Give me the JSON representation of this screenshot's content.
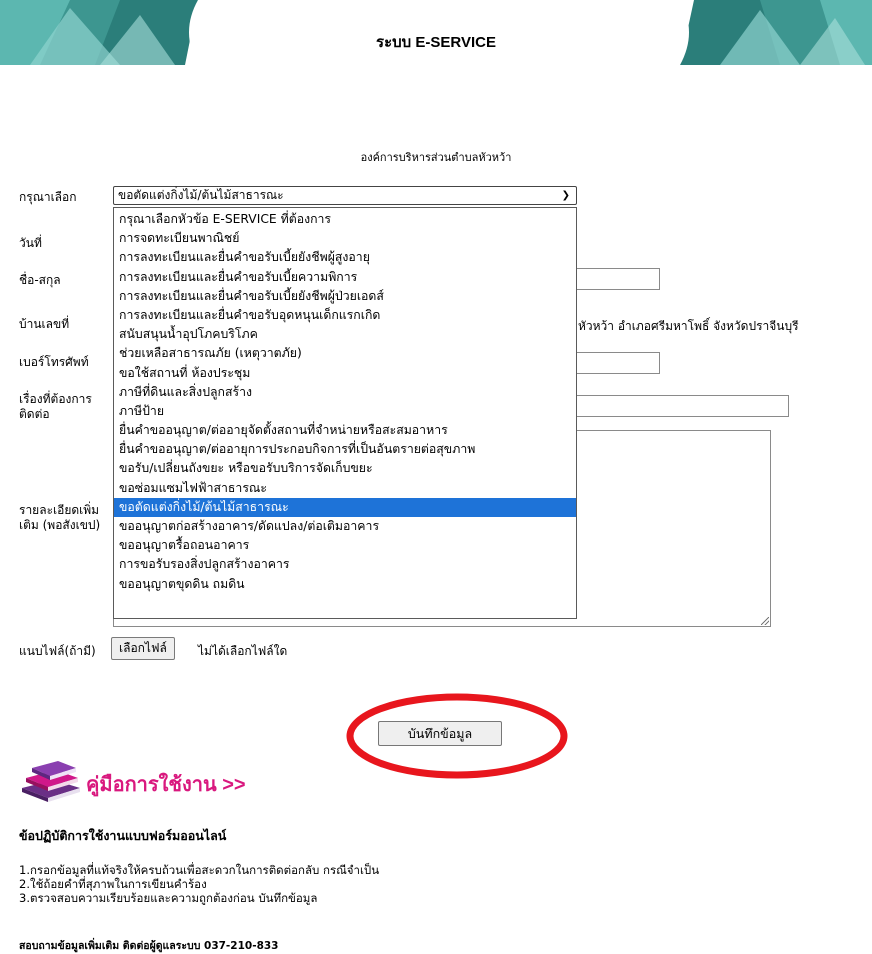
{
  "header": {
    "system_title": "ระบบ E-SERVICE",
    "org_name": "องค์การบริหารส่วนตำบลหัวหว้า",
    "banner_colors": [
      "#2a7f7b",
      "#55b4ae",
      "#8fd3ce"
    ]
  },
  "form": {
    "labels": {
      "topic": "กรุณาเลือก",
      "date": "วันที่",
      "name": "ชื่อ-สกุล",
      "address": "บ้านเลขที่",
      "phone": "เบอร์โทรศัพท์",
      "subject": "เรื่องที่ต้องการติดต่อ",
      "details": "รายละเอียดเพิ่มเติม (พอสังเขป)",
      "attach": "แนบไฟล์(ถ้ามี)"
    },
    "address_suffix": "หัวหว้า อำเภอศรีมหาโพธิ์ จังหวัดปราจีนบุรี",
    "selected_topic": "ขอตัดแต่งกิ่งไม้/ต้นไม้สาธารณะ",
    "topic_options": [
      "กรุณาเลือกหัวข้อ E-SERVICE ที่ต้องการ",
      "การจดทะเบียนพาณิชย์",
      "การลงทะเบียนและยื่นคำขอรับเบี้ยยังชีพผู้สูงอายุ",
      "การลงทะเบียนและยื่นคำขอรับเบี้ยความพิการ",
      "การลงทะเบียนและยื่นคำขอรับเบี้ยยังชีพผู้ป่วยเอดส์",
      "การลงทะเบียนและยื่นคำขอรับอุดหนุนเด็กแรกเกิด",
      "สนับสนุนน้ำอุปโภคบริโภค",
      "ช่วยเหลือสาธารณภัย (เหตุวาตภัย)",
      "ขอใช้สถานที่ ห้องประชุม",
      "ภาษีที่ดินและสิ่งปลูกสร้าง",
      "ภาษีป้าย",
      "ยื่นคำขออนุญาต/ต่ออายุจัดตั้งสถานที่จำหน่ายหรือสะสมอาหาร",
      "ยื่นคำขออนุญาต/ต่ออายุการประกอบกิจการที่เป็นอันตรายต่อสุขภาพ",
      "ขอรับ/เปลี่ยนถังขยะ หรือขอรับบริการจัดเก็บขยะ",
      "ขอซ่อมแซมไฟฟ้าสาธารณะ",
      "ขอตัดแต่งกิ่งไม้/ต้นไม้สาธารณะ",
      "ขออนุญาตก่อสร้างอาคาร/ดัดแปลง/ต่อเติมอาคาร",
      "ขออนุญาตรื้อถอนอาคาร",
      "การขอรับรองสิ่งปลูกสร้างอาคาร",
      "ขออนุญาตขุดดิน ถมดิน"
    ],
    "selected_index": 15,
    "choose_file_label": "เลือกไฟล์",
    "no_file_text": "ไม่ได้เลือกไฟล์ใด",
    "save_label": "บันทึกข้อมูล"
  },
  "manual": {
    "label": "คู่มือการใช้งาน >>"
  },
  "rules": {
    "title": "ข้อปฏิบัติการใช้งานแบบฟอร์มออนไลน์",
    "items": [
      "1.กรอกข้อมูลที่แท้จริงให้ครบถ้วนเพื่อสะดวกในการติดต่อกลับ กรณีจำเป็น",
      "2.ใช้ถ้อยคำที่สุภาพในการเขียนคำร้อง",
      "3.ตรวจสอบความเรียบร้อยและความถูกต้องก่อน บันทึกข้อมูล"
    ]
  },
  "footer": {
    "contact": "สอบถามข้อมูลเพิ่มเติม ติดต่อผู้ดูแลระบบ  037-210-833"
  },
  "colors": {
    "highlight": "#e8161d",
    "selected_option": "#1e73d8",
    "manual_pink": "#d9187e"
  }
}
